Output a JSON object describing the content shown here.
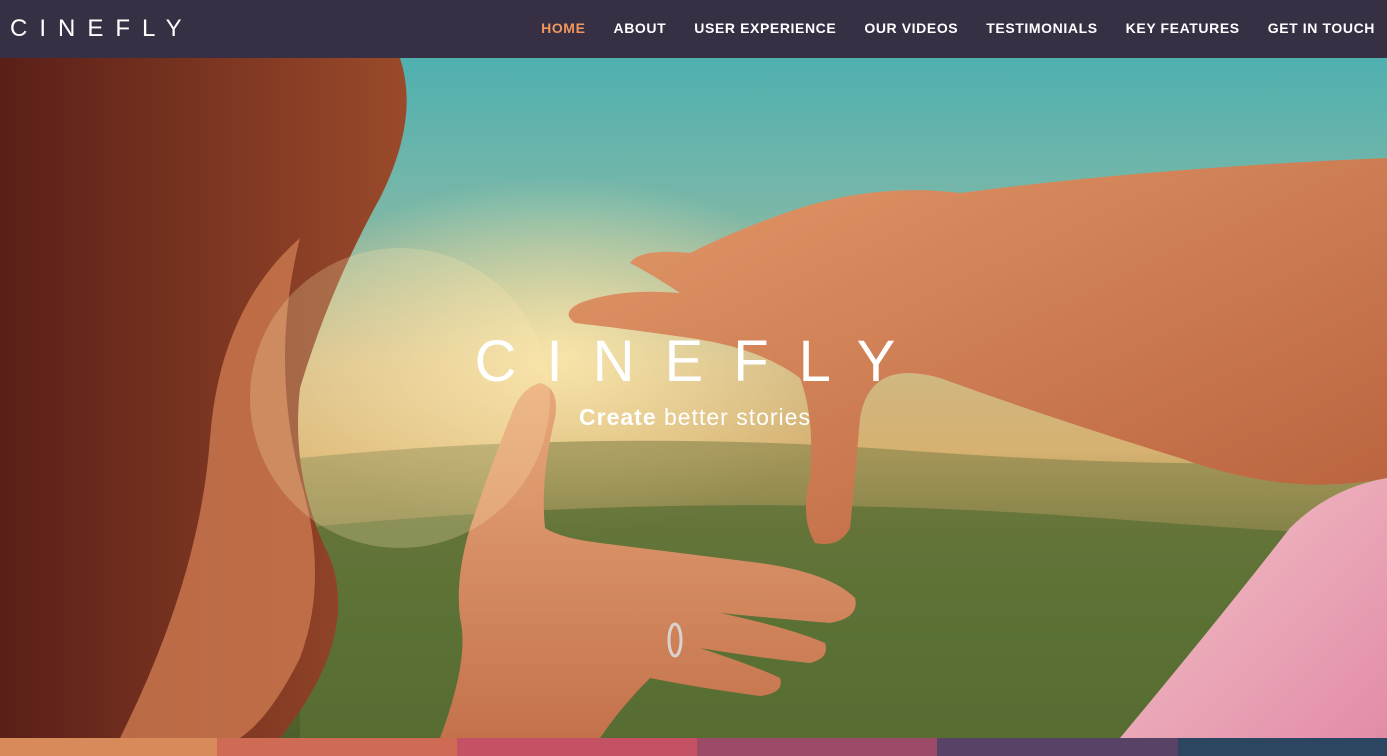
{
  "brand": {
    "logo_text": "CINEFLY"
  },
  "nav": {
    "items": [
      {
        "label": "HOME",
        "active": true
      },
      {
        "label": "ABOUT",
        "active": false
      },
      {
        "label": "USER EXPERIENCE",
        "active": false
      },
      {
        "label": "OUR VIDEOS",
        "active": false
      },
      {
        "label": "TESTIMONIALS",
        "active": false
      },
      {
        "label": "KEY FEATURES",
        "active": false
      },
      {
        "label": "GET IN TOUCH",
        "active": false
      }
    ]
  },
  "hero": {
    "title": "CINEFLY",
    "tagline_strong": "Create",
    "tagline_rest": "better stories",
    "image_icon": "hands-framing-landscape-photo"
  },
  "colors": {
    "topbar": "#373044",
    "nav_text": "#ffffff",
    "nav_active": "#f0965f",
    "strip": [
      "#d88a5a",
      "#cf6a55",
      "#c55264",
      "#9c4a68",
      "#584265",
      "#2c4560"
    ]
  }
}
